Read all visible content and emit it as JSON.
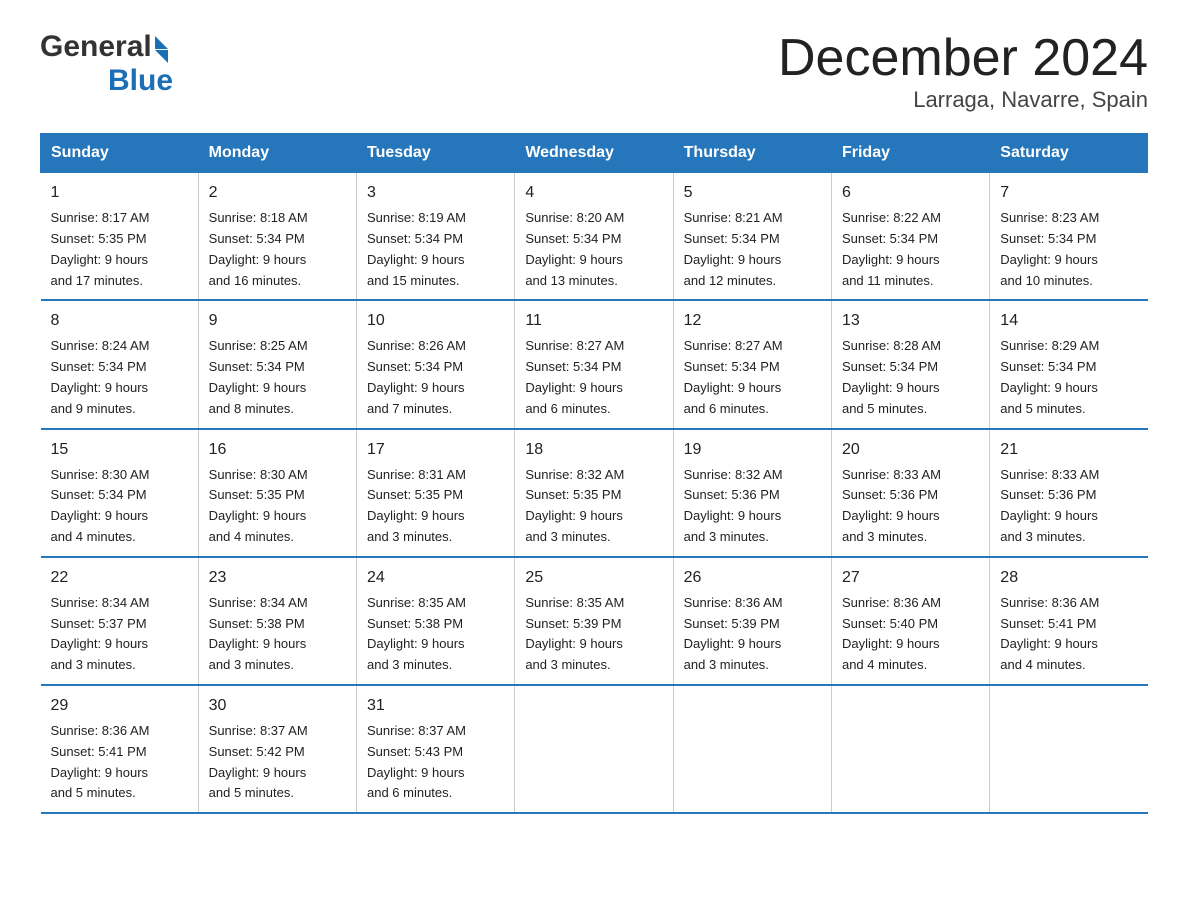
{
  "header": {
    "logo_text_general": "General",
    "logo_text_blue": "Blue",
    "month_title": "December 2024",
    "location": "Larraga, Navarre, Spain"
  },
  "days_of_week": [
    "Sunday",
    "Monday",
    "Tuesday",
    "Wednesday",
    "Thursday",
    "Friday",
    "Saturday"
  ],
  "weeks": [
    [
      {
        "day": "1",
        "sunrise": "8:17 AM",
        "sunset": "5:35 PM",
        "daylight": "9 hours and 17 minutes."
      },
      {
        "day": "2",
        "sunrise": "8:18 AM",
        "sunset": "5:34 PM",
        "daylight": "9 hours and 16 minutes."
      },
      {
        "day": "3",
        "sunrise": "8:19 AM",
        "sunset": "5:34 PM",
        "daylight": "9 hours and 15 minutes."
      },
      {
        "day": "4",
        "sunrise": "8:20 AM",
        "sunset": "5:34 PM",
        "daylight": "9 hours and 13 minutes."
      },
      {
        "day": "5",
        "sunrise": "8:21 AM",
        "sunset": "5:34 PM",
        "daylight": "9 hours and 12 minutes."
      },
      {
        "day": "6",
        "sunrise": "8:22 AM",
        "sunset": "5:34 PM",
        "daylight": "9 hours and 11 minutes."
      },
      {
        "day": "7",
        "sunrise": "8:23 AM",
        "sunset": "5:34 PM",
        "daylight": "9 hours and 10 minutes."
      }
    ],
    [
      {
        "day": "8",
        "sunrise": "8:24 AM",
        "sunset": "5:34 PM",
        "daylight": "9 hours and 9 minutes."
      },
      {
        "day": "9",
        "sunrise": "8:25 AM",
        "sunset": "5:34 PM",
        "daylight": "9 hours and 8 minutes."
      },
      {
        "day": "10",
        "sunrise": "8:26 AM",
        "sunset": "5:34 PM",
        "daylight": "9 hours and 7 minutes."
      },
      {
        "day": "11",
        "sunrise": "8:27 AM",
        "sunset": "5:34 PM",
        "daylight": "9 hours and 6 minutes."
      },
      {
        "day": "12",
        "sunrise": "8:27 AM",
        "sunset": "5:34 PM",
        "daylight": "9 hours and 6 minutes."
      },
      {
        "day": "13",
        "sunrise": "8:28 AM",
        "sunset": "5:34 PM",
        "daylight": "9 hours and 5 minutes."
      },
      {
        "day": "14",
        "sunrise": "8:29 AM",
        "sunset": "5:34 PM",
        "daylight": "9 hours and 5 minutes."
      }
    ],
    [
      {
        "day": "15",
        "sunrise": "8:30 AM",
        "sunset": "5:34 PM",
        "daylight": "9 hours and 4 minutes."
      },
      {
        "day": "16",
        "sunrise": "8:30 AM",
        "sunset": "5:35 PM",
        "daylight": "9 hours and 4 minutes."
      },
      {
        "day": "17",
        "sunrise": "8:31 AM",
        "sunset": "5:35 PM",
        "daylight": "9 hours and 3 minutes."
      },
      {
        "day": "18",
        "sunrise": "8:32 AM",
        "sunset": "5:35 PM",
        "daylight": "9 hours and 3 minutes."
      },
      {
        "day": "19",
        "sunrise": "8:32 AM",
        "sunset": "5:36 PM",
        "daylight": "9 hours and 3 minutes."
      },
      {
        "day": "20",
        "sunrise": "8:33 AM",
        "sunset": "5:36 PM",
        "daylight": "9 hours and 3 minutes."
      },
      {
        "day": "21",
        "sunrise": "8:33 AM",
        "sunset": "5:36 PM",
        "daylight": "9 hours and 3 minutes."
      }
    ],
    [
      {
        "day": "22",
        "sunrise": "8:34 AM",
        "sunset": "5:37 PM",
        "daylight": "9 hours and 3 minutes."
      },
      {
        "day": "23",
        "sunrise": "8:34 AM",
        "sunset": "5:38 PM",
        "daylight": "9 hours and 3 minutes."
      },
      {
        "day": "24",
        "sunrise": "8:35 AM",
        "sunset": "5:38 PM",
        "daylight": "9 hours and 3 minutes."
      },
      {
        "day": "25",
        "sunrise": "8:35 AM",
        "sunset": "5:39 PM",
        "daylight": "9 hours and 3 minutes."
      },
      {
        "day": "26",
        "sunrise": "8:36 AM",
        "sunset": "5:39 PM",
        "daylight": "9 hours and 3 minutes."
      },
      {
        "day": "27",
        "sunrise": "8:36 AM",
        "sunset": "5:40 PM",
        "daylight": "9 hours and 4 minutes."
      },
      {
        "day": "28",
        "sunrise": "8:36 AM",
        "sunset": "5:41 PM",
        "daylight": "9 hours and 4 minutes."
      }
    ],
    [
      {
        "day": "29",
        "sunrise": "8:36 AM",
        "sunset": "5:41 PM",
        "daylight": "9 hours and 5 minutes."
      },
      {
        "day": "30",
        "sunrise": "8:37 AM",
        "sunset": "5:42 PM",
        "daylight": "9 hours and 5 minutes."
      },
      {
        "day": "31",
        "sunrise": "8:37 AM",
        "sunset": "5:43 PM",
        "daylight": "9 hours and 6 minutes."
      },
      null,
      null,
      null,
      null
    ]
  ],
  "labels": {
    "sunrise": "Sunrise:",
    "sunset": "Sunset:",
    "daylight": "Daylight:"
  }
}
